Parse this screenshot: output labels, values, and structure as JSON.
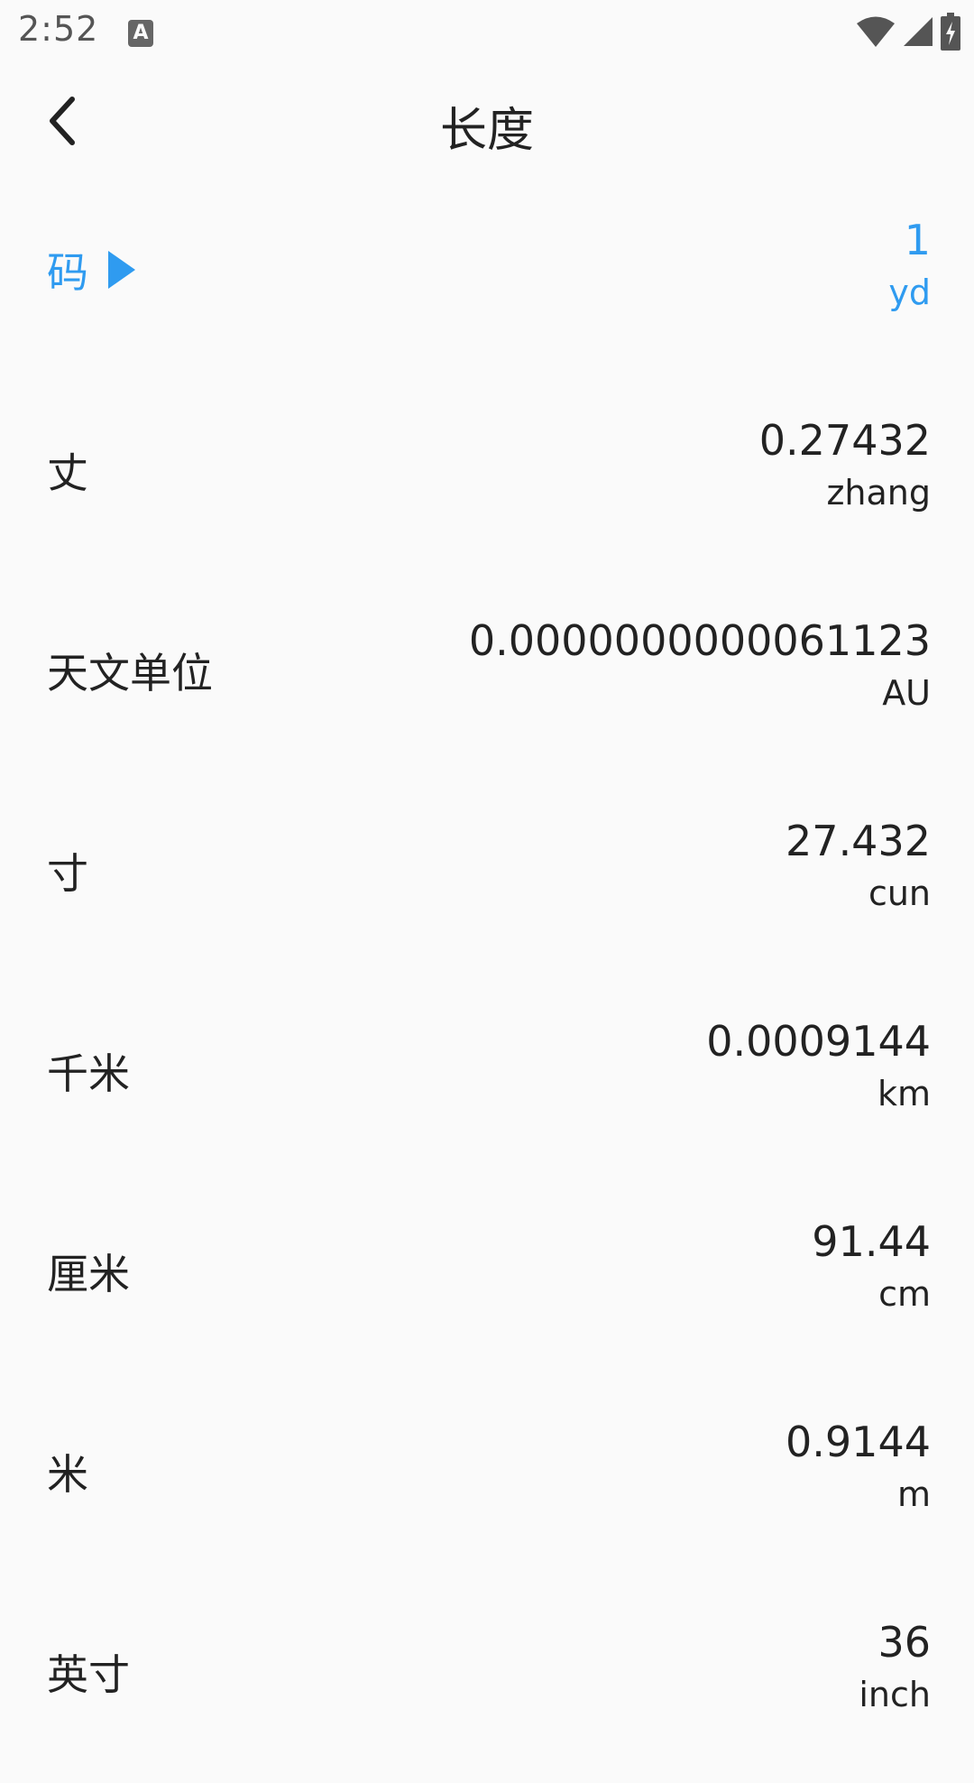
{
  "status_bar": {
    "time": "2:52",
    "notification_icon": "A"
  },
  "app_bar": {
    "title": "长度"
  },
  "icons": {
    "back": "chevron-left-icon",
    "selected_marker": "play-triangle-icon",
    "wifi": "wifi-icon",
    "cell": "cell-signal-icon",
    "battery": "battery-charging-icon"
  },
  "colors": {
    "accent": "#2f9bf0",
    "text": "#222222",
    "background": "#fafafa"
  },
  "units": [
    {
      "name": "码",
      "value": "1",
      "unit": "yd",
      "selected": true
    },
    {
      "name": "丈",
      "value": "0.27432",
      "unit": "zhang"
    },
    {
      "name": "天文单位",
      "value": "0.0000000000061123",
      "unit": "AU"
    },
    {
      "name": "寸",
      "value": "27.432",
      "unit": "cun"
    },
    {
      "name": "千米",
      "value": "0.0009144",
      "unit": "km"
    },
    {
      "name": "厘米",
      "value": "91.44",
      "unit": "cm"
    },
    {
      "name": "米",
      "value": "0.9144",
      "unit": "m"
    },
    {
      "name": "英寸",
      "value": "36",
      "unit": "inch"
    }
  ]
}
